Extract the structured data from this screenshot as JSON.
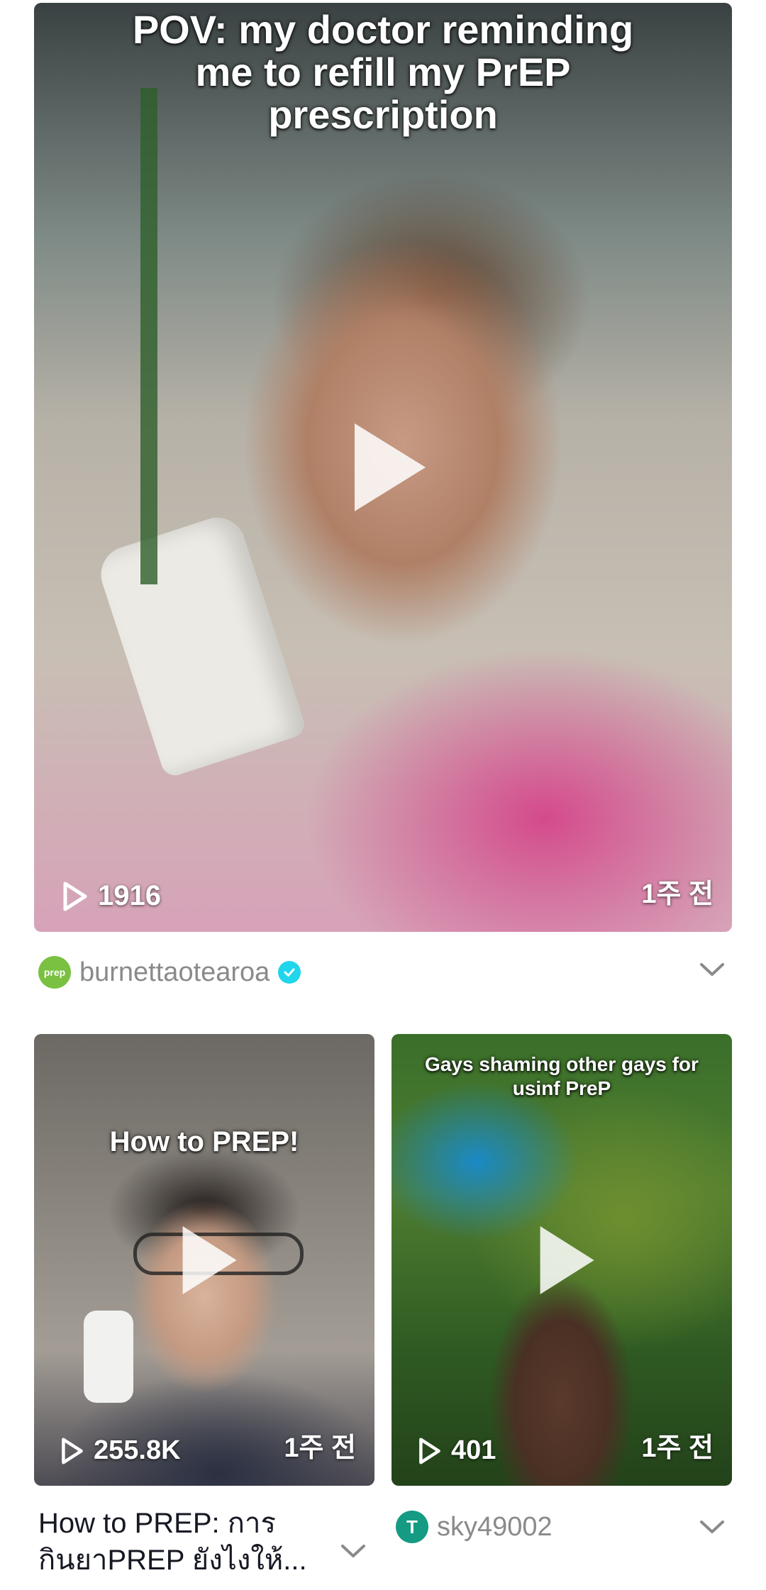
{
  "colors": {
    "verified": "#20d5ec",
    "author_text": "#8a8a8a",
    "caption_text": "#161823",
    "avatar_prep": "#7ac142",
    "avatar_sky": "#159a84"
  },
  "feed": {
    "featured": {
      "overlay_lines": [
        "POV: my doctor reminding",
        "me to refill my PrEP",
        "prescription"
      ],
      "views": "1916",
      "time_ago": "1주 전",
      "author": "burnettaotearoa",
      "avatar_text": "prep",
      "verified": true
    },
    "left": {
      "overlay_text": "How to PREP!",
      "views": "255.8K",
      "time_ago": "1주 전",
      "caption_lines": [
        "How to PREP: การ",
        "กินยาPREP ยังไงให้..."
      ]
    },
    "right": {
      "overlay_lines": [
        "Gays shaming other gays for",
        "usinf PreP"
      ],
      "views": "401",
      "time_ago": "1주 전",
      "author": "sky49002",
      "avatar_letter": "T"
    }
  }
}
